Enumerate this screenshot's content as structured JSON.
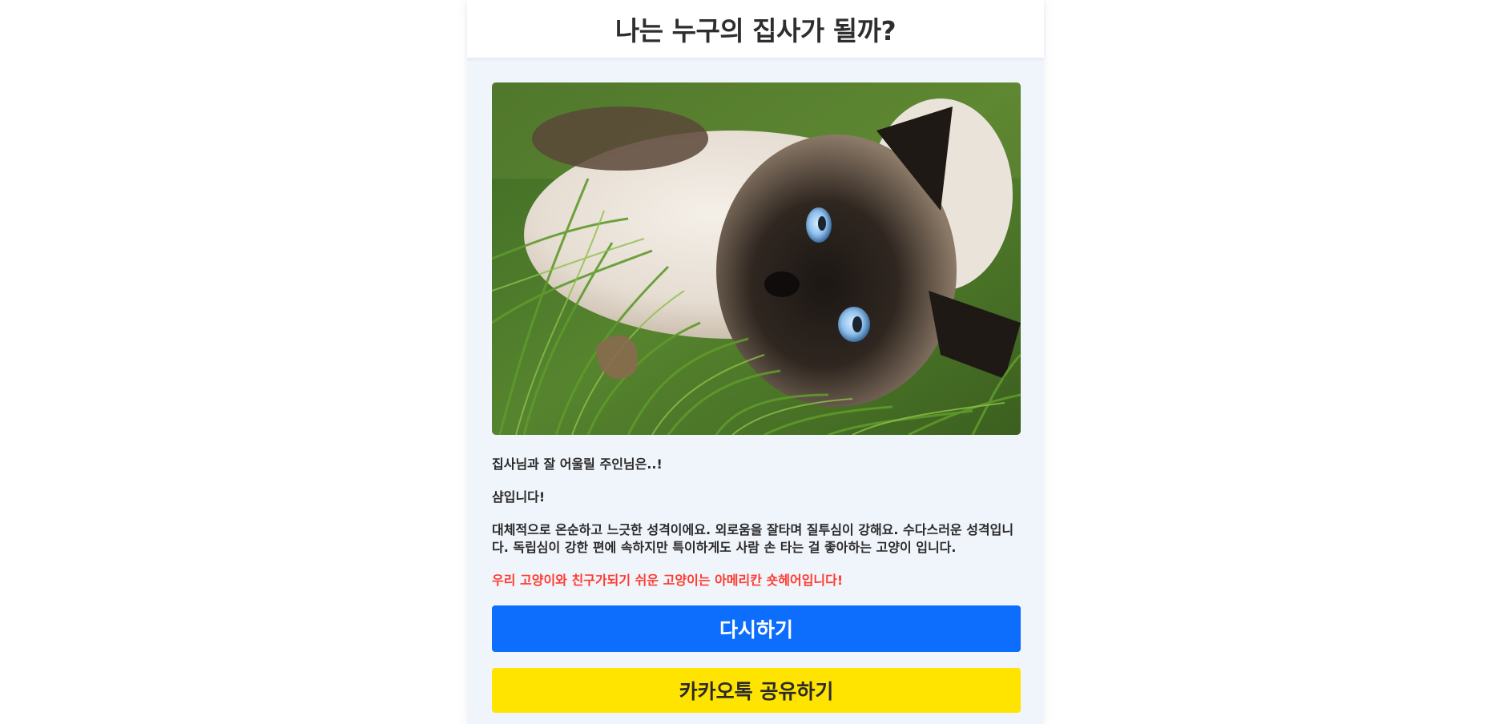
{
  "header": {
    "title": "나는 누구의 집사가 될까?"
  },
  "result": {
    "image_subject": "siamese-cat-photo",
    "intro": "집사님과 잘 어울릴 주인님은..!",
    "breed": "샴입니다!",
    "description": "대체적으로 온순하고 느긋한 성격이에요. 외로움을 잘타며 질투심이 강해요. 수다스러운 성격입니다. 독립심이 강한 편에 속하지만 특이하게도 사람 손 타는 걸 좋아하는 고양이 입니다.",
    "friend_note": "우리 고양이와 친구가되기 쉬운 고양이는 아메리칸 숏헤어입니다!"
  },
  "buttons": {
    "retry_label": "다시하기",
    "share_label": "카카오톡 공유하기"
  },
  "colors": {
    "page_background": "#f0f4fb",
    "retry_button": "#0d6efd",
    "share_button": "#ffe400",
    "highlight_text": "#ff3b30"
  }
}
